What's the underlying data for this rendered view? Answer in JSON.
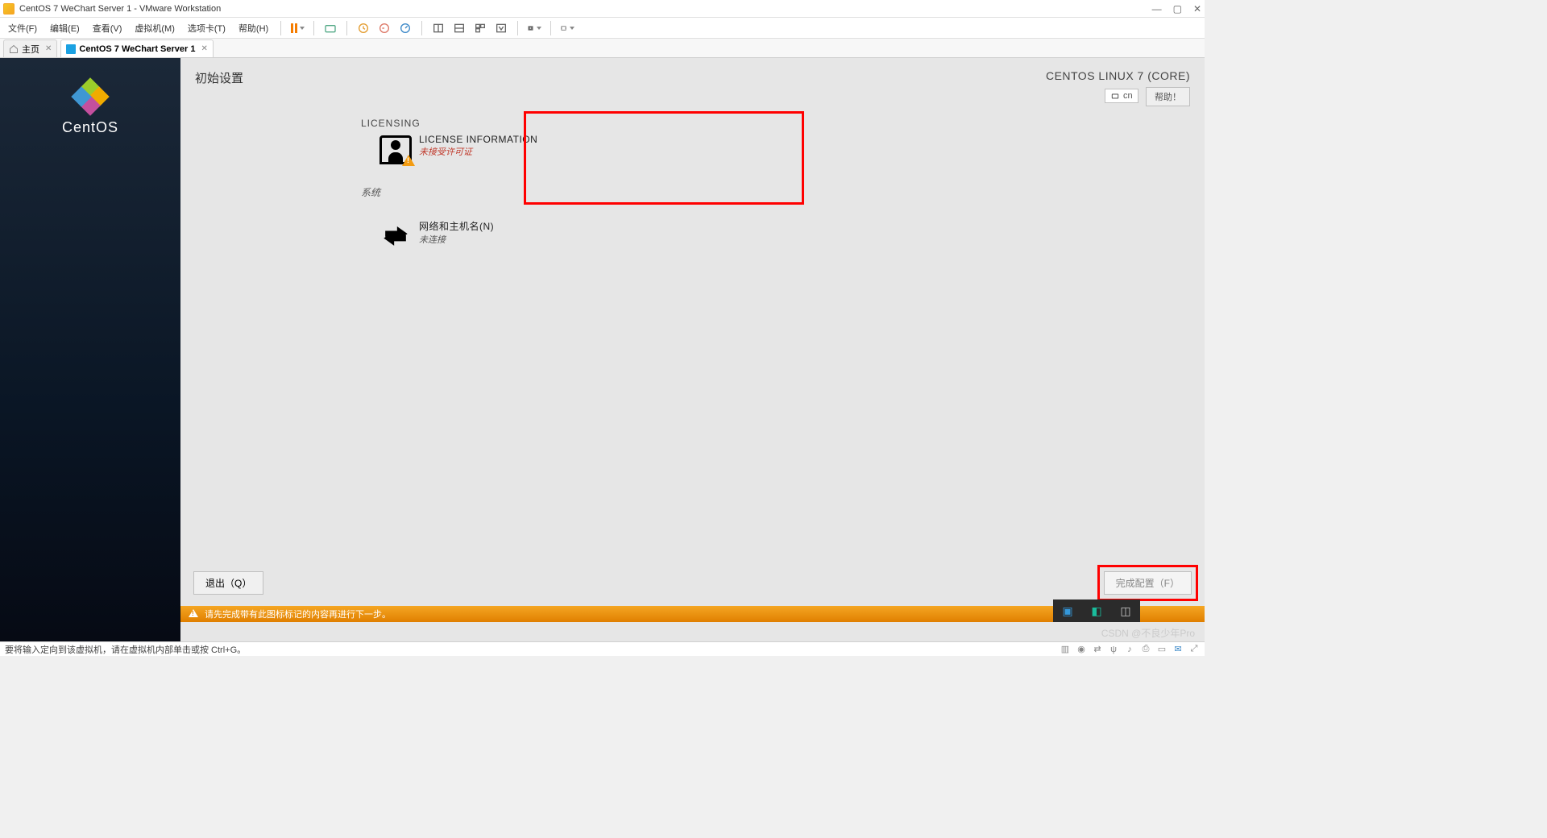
{
  "window": {
    "title": "CentOS 7 WeChart Server 1 - VMware Workstation"
  },
  "menu": {
    "file": "文件(F)",
    "edit": "编辑(E)",
    "view": "查看(V)",
    "vm": "虚拟机(M)",
    "tabs": "选项卡(T)",
    "help": "帮助(H)"
  },
  "tabs": {
    "home": "主页",
    "vm": "CentOS 7 WeChart Server 1"
  },
  "sidebar": {
    "product": "CentOS"
  },
  "guest": {
    "page_title": "初始设置",
    "distro": "CENTOS LINUX 7 (CORE)",
    "lang": "cn",
    "help_btn": "帮助！",
    "licensing": {
      "category": "LICENSING",
      "item_title": "LICENSE INFORMATION",
      "item_status": "未接受许可证",
      "system_label": "系统"
    },
    "network": {
      "item_title": "网络和主机名(N)",
      "item_status": "未连接"
    },
    "buttons": {
      "quit": "退出（Q）",
      "finish": "完成配置（F）"
    },
    "warnbar": "请先完成带有此图标标记的内容再进行下一步。"
  },
  "statusbar": {
    "hint": "要将输入定向到该虚拟机，请在虚拟机内部单击或按 Ctrl+G。"
  },
  "watermark": "CSDN @不良少年Pro"
}
